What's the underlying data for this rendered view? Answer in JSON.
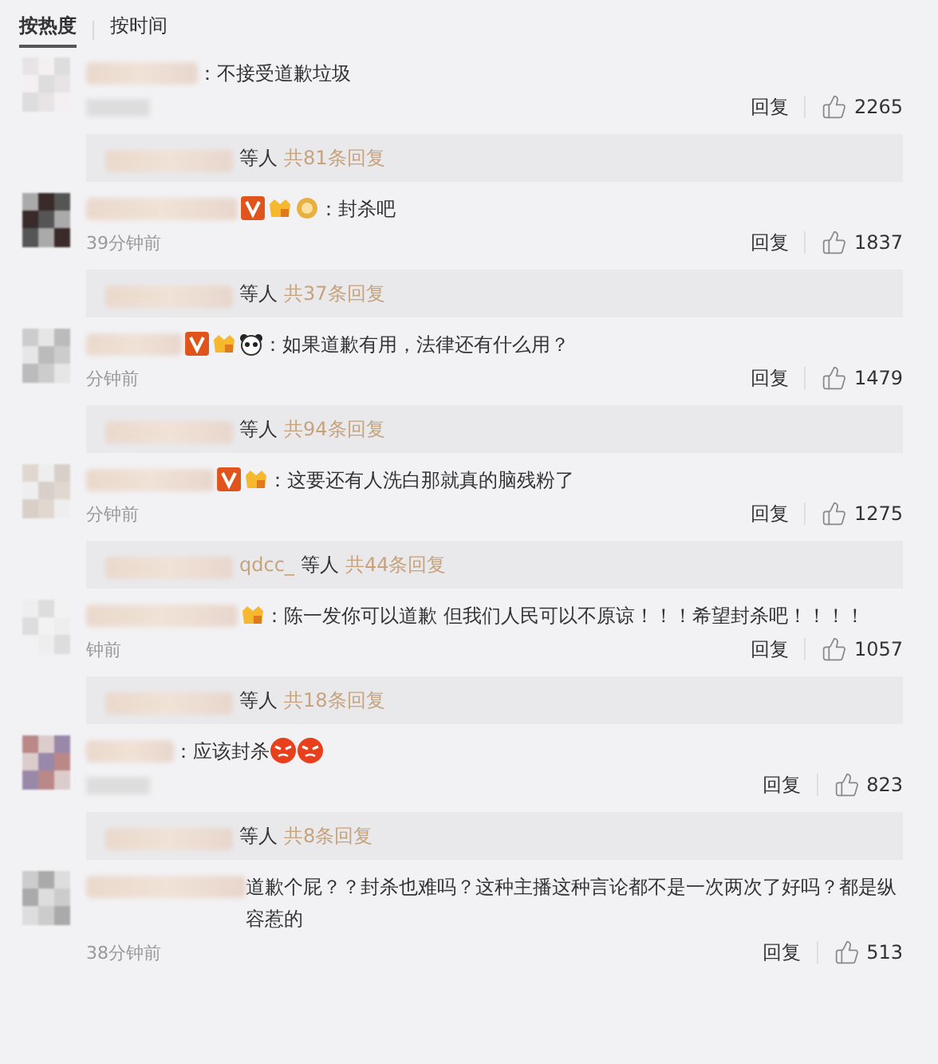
{
  "sort_tabs": [
    {
      "label": "按热度",
      "selected": true
    },
    {
      "label": "按时间",
      "selected": false
    }
  ],
  "comments": [
    {
      "text": "：不接受道歉垃圾",
      "reply": "回复",
      "likes": "2265",
      "preview": {
        "others": "等人",
        "count": "共81条回复"
      }
    },
    {
      "badges": [
        {
          "kind": "vip"
        },
        {
          "kind": "fan"
        },
        {
          "kind": "medal"
        }
      ],
      "text": "：封杀吧",
      "time": "39分钟前",
      "reply": "回复",
      "likes": "1837",
      "preview": {
        "others": "等人",
        "count": "共37条回复"
      }
    },
    {
      "badges": [
        {
          "kind": "vip"
        },
        {
          "kind": "fan"
        },
        {
          "kind": "panda"
        }
      ],
      "text": "：如果道歉有用，法律还有什么用？",
      "time": "分钟前",
      "reply": "回复",
      "likes": "1479",
      "preview": {
        "others": "等人",
        "count": "共94条回复"
      }
    },
    {
      "badges": [
        {
          "kind": "vip"
        },
        {
          "kind": "fan"
        }
      ],
      "text": "：这要还有人洗白那就真的脑残粉了",
      "time": "分钟前",
      "reply": "回复",
      "likes": "1275",
      "preview": {
        "user": "qdcc_",
        "others": "等人",
        "count": "共44条回复"
      }
    },
    {
      "badges": [
        {
          "kind": "fan"
        }
      ],
      "text": "：陈一发你可以道歉 但我们人民可以不原谅！！！希望封杀吧！！！！",
      "time": "钟前",
      "reply": "回复",
      "likes": "1057",
      "preview": {
        "others": "等人",
        "count": "共18条回复"
      }
    },
    {
      "text": "：应该封杀",
      "emojis": [
        {
          "kind": "angry"
        },
        {
          "kind": "angry"
        }
      ],
      "reply": "回复",
      "likes": "823",
      "preview": {
        "others": "等人",
        "count": "共8条回复"
      }
    },
    {
      "text": "道歉个屁？？封杀也难吗？这种主播这种言论都不是一次两次了好吗？都是纵容惹的",
      "time": "38分钟前",
      "reply": "回复",
      "likes": "513"
    }
  ]
}
